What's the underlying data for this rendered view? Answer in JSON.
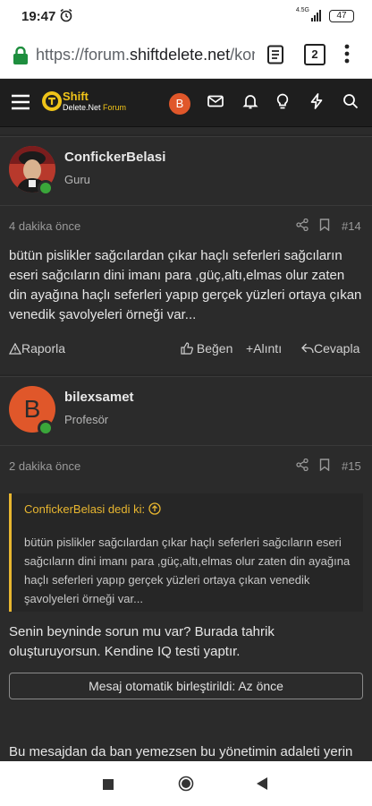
{
  "status": {
    "time": "19:47",
    "network": "4.5G",
    "battery": "47"
  },
  "browser": {
    "url_prefix": "https://forum.",
    "url_domain": "shiftdelete.net",
    "url_suffix": "/kon",
    "tab_count": "2"
  },
  "forum": {
    "brand_top": "Shift",
    "brand_bottom_a": "Delete",
    "brand_bottom_b": ".Net",
    "brand_bottom_c": " Forum",
    "user_initial": "B"
  },
  "posts": [
    {
      "username": "ConfickerBelasi",
      "title": "Guru",
      "time": "4 dakika önce",
      "number": "#14",
      "text": "bütün pislikler sağcılardan çıkar haçlı seferleri sağcıların eseri sağcıların dini imanı para ,güç,altı,elmas olur zaten din ayağına haçlı seferleri yapıp gerçek yüzleri ortaya çıkan venedik şavolyeleri örneği var...",
      "report": "Raporla",
      "like": "Beğen",
      "quote": "Alıntı",
      "reply": "Cevapla"
    },
    {
      "username": "bilexsamet",
      "title": "Profesör",
      "avatar_initial": "B",
      "time": "2 dakika önce",
      "number": "#15",
      "quote_author": "ConfickerBelasi dedi ki:",
      "quote_text": "bütün pislikler sağcılardan çıkar haçlı seferleri sağcıların eseri sağcıların dini imanı para ,güç,altı,elmas olur zaten din ayağına haçlı seferleri yapıp gerçek yüzleri ortaya çıkan venedik şavolyeleri örneği var...",
      "text": "Senin beyninde sorun mu var? Burada tahrik oluşturuyorsun. Kendine IQ testi yaptır.",
      "merged_note": "Mesaj otomatik birleştirildi: Az önce",
      "text2": "Bu mesajdan da ban yemezsen bu yönetimin adaleti yerin"
    }
  ],
  "colors": {
    "accent": "#e8b630",
    "online": "#3aa63a",
    "avatar_orange": "#e0572a"
  }
}
